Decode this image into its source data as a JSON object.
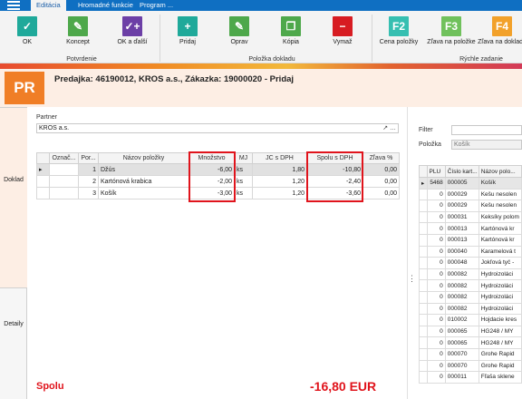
{
  "tabs": [
    "Editácia",
    "Hromadné funkcie",
    "Program ..."
  ],
  "ribbon": {
    "buttons": {
      "ok": "OK",
      "koncept": "Koncept",
      "ok_dalsi": "OK a ďalší",
      "pridaj": "Pridaj",
      "oprav": "Oprav",
      "kopia": "Kópia",
      "vymaz": "Vymaž",
      "f2_key": "F2",
      "f2_label": "Cena položky",
      "f3_key": "F3",
      "f3_label": "Zľava na položke",
      "f4_key": "F4",
      "f4_label": "Zľava na doklade"
    },
    "groups": {
      "potvrdenie": "Potvrdenie",
      "polozka_dokladu": "Položka dokladu",
      "rychle_zadanie": "Rýchle zadanie"
    },
    "colors": {
      "teal": "#1fa99a",
      "green": "#4ea84b",
      "purple": "#6c3fa6",
      "red": "#d71c22",
      "f_teal": "#36bfb1",
      "f_green": "#70c15c",
      "f_orange": "#f2a12a"
    }
  },
  "header": {
    "badge": "PR",
    "title": "Predajka: 46190012, KROS a.s., Zákazka: 19000020 - Pridaj"
  },
  "side_tabs": [
    "Doklad",
    "Detaily"
  ],
  "partner": {
    "label": "Partner",
    "value": "KROS a.s.",
    "icons": "↗ …"
  },
  "grid": {
    "columns": [
      "Označ...",
      "Por...",
      "Názov položky",
      "Množstvo",
      "MJ",
      "JC s DPH",
      "Spolu s DPH",
      "Zľava %"
    ],
    "rows": [
      {
        "marker": "▸",
        "por": "1",
        "nazov": "Džús",
        "mnozstvo": "-6,00",
        "mj": "ks",
        "jc": "1,80",
        "spolu": "-10,80",
        "zlava": "0,00"
      },
      {
        "marker": "",
        "por": "2",
        "nazov": "Kartónová krabica",
        "mnozstvo": "-2,00",
        "mj": "ks",
        "jc": "1,20",
        "spolu": "-2,40",
        "zlava": "0,00"
      },
      {
        "marker": "",
        "por": "3",
        "nazov": "Košík",
        "mnozstvo": "-3,00",
        "mj": "ks",
        "jc": "1,20",
        "spolu": "-3,60",
        "zlava": "0,00"
      }
    ]
  },
  "total": {
    "label": "Spolu",
    "value": "-16,80 EUR"
  },
  "right_panel": {
    "filter_label": "Filter",
    "polozka_label": "Položka",
    "polozka_value": "Košík",
    "columns": [
      "PLU",
      "Číslo kart...",
      "Názov polo..."
    ],
    "rows": [
      {
        "marker": "▸",
        "plu": "5468",
        "cislo": "000005",
        "nazov": "Košík"
      },
      {
        "marker": "",
        "plu": "0",
        "cislo": "000029",
        "nazov": "Kešu nesolen"
      },
      {
        "marker": "",
        "plu": "0",
        "cislo": "000029",
        "nazov": "Kešu nesolen"
      },
      {
        "marker": "",
        "plu": "0",
        "cislo": "000031",
        "nazov": "Keksíky polom"
      },
      {
        "marker": "",
        "plu": "0",
        "cislo": "000013",
        "nazov": "Kartónová kr"
      },
      {
        "marker": "",
        "plu": "0",
        "cislo": "000013",
        "nazov": "Kartónová kr"
      },
      {
        "marker": "",
        "plu": "0",
        "cislo": "000040",
        "nazov": "Karamelová t"
      },
      {
        "marker": "",
        "plu": "0",
        "cislo": "000048",
        "nazov": "Jokľová tyč -"
      },
      {
        "marker": "",
        "plu": "0",
        "cislo": "000082",
        "nazov": "Hydroizoláci"
      },
      {
        "marker": "",
        "plu": "0",
        "cislo": "000082",
        "nazov": "Hydroizoláci"
      },
      {
        "marker": "",
        "plu": "0",
        "cislo": "000082",
        "nazov": "Hydroizoláci"
      },
      {
        "marker": "",
        "plu": "0",
        "cislo": "000082",
        "nazov": "Hydroizoláci"
      },
      {
        "marker": "",
        "plu": "0",
        "cislo": "010002",
        "nazov": "Hojdacie kres"
      },
      {
        "marker": "",
        "plu": "0",
        "cislo": "000065",
        "nazov": "HG248 / MY"
      },
      {
        "marker": "",
        "plu": "0",
        "cislo": "000065",
        "nazov": "HG248 / MY"
      },
      {
        "marker": "",
        "plu": "0",
        "cislo": "000070",
        "nazov": "Grohe Rapid"
      },
      {
        "marker": "",
        "plu": "0",
        "cislo": "000070",
        "nazov": "Grohe Rapid"
      },
      {
        "marker": "",
        "plu": "0",
        "cislo": "000011",
        "nazov": "Fľaša sklene"
      }
    ]
  }
}
